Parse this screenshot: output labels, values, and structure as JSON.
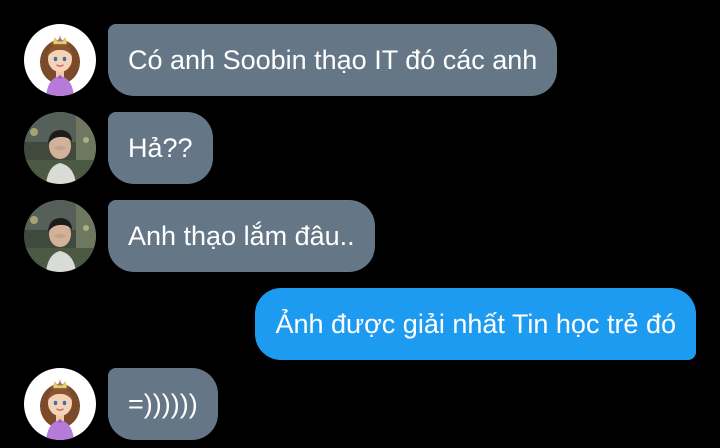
{
  "colors": {
    "background": "#000000",
    "incoming_bubble": "#657786",
    "outgoing_bubble": "#1d9bf0",
    "text": "#ffffff"
  },
  "conversation": {
    "messages": [
      {
        "direction": "incoming",
        "avatar": "princess-avatar-icon",
        "text": "Có anh Soobin thạo IT đó các anh"
      },
      {
        "direction": "incoming",
        "avatar": "man-photo-avatar-icon",
        "text": "Hả??"
      },
      {
        "direction": "incoming",
        "avatar": "man-photo-avatar-icon",
        "text": "Anh thạo lắm đâu.."
      },
      {
        "direction": "outgoing",
        "avatar": null,
        "text": "Ảnh được giải nhất Tin học trẻ đó"
      },
      {
        "direction": "incoming",
        "avatar": "princess-avatar-icon",
        "text": "=))))))"
      }
    ]
  }
}
